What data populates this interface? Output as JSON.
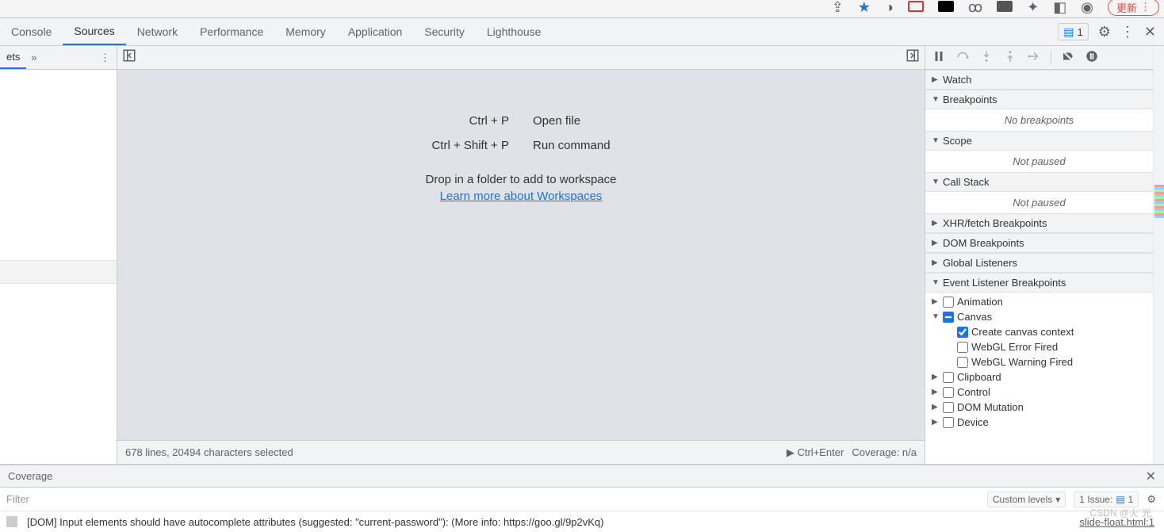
{
  "browser": {
    "update_label": "更新",
    "star": true
  },
  "devtools_tabs": {
    "items": [
      "Console",
      "Sources",
      "Network",
      "Performance",
      "Memory",
      "Application",
      "Security",
      "Lighthouse"
    ],
    "active": "Sources",
    "issues_label": "1"
  },
  "navigator": {
    "truncated_tab": "ets"
  },
  "editor": {
    "hints": [
      {
        "keys": "Ctrl + P",
        "action": "Open file"
      },
      {
        "keys": "Ctrl + Shift + P",
        "action": "Run command"
      }
    ],
    "drop_text": "Drop in a folder to add to workspace",
    "link_text": "Learn more about Workspaces",
    "status_left": "678 lines, 20494 characters selected",
    "status_run": "Ctrl+Enter",
    "status_coverage": "Coverage: n/a"
  },
  "debugger": {
    "panes": {
      "watch": {
        "title": "Watch",
        "expanded": false
      },
      "breakpoints": {
        "title": "Breakpoints",
        "expanded": true,
        "empty": "No breakpoints"
      },
      "scope": {
        "title": "Scope",
        "expanded": true,
        "msg": "Not paused"
      },
      "callstack": {
        "title": "Call Stack",
        "expanded": true,
        "msg": "Not paused"
      },
      "xhr": {
        "title": "XHR/fetch Breakpoints",
        "expanded": false
      },
      "dom_bp": {
        "title": "DOM Breakpoints",
        "expanded": false
      },
      "global": {
        "title": "Global Listeners",
        "expanded": false
      },
      "evt": {
        "title": "Event Listener Breakpoints",
        "expanded": true,
        "groups": [
          {
            "name": "Animation",
            "expanded": false,
            "checked": false
          },
          {
            "name": "Canvas",
            "expanded": true,
            "checked": "indeterminate",
            "children": [
              {
                "name": "Create canvas context",
                "checked": true
              },
              {
                "name": "WebGL Error Fired",
                "checked": false
              },
              {
                "name": "WebGL Warning Fired",
                "checked": false
              }
            ]
          },
          {
            "name": "Clipboard",
            "expanded": false,
            "checked": false
          },
          {
            "name": "Control",
            "expanded": false,
            "checked": false
          },
          {
            "name": "DOM Mutation",
            "expanded": false,
            "checked": false
          },
          {
            "name": "Device",
            "expanded": false,
            "checked": false
          }
        ]
      }
    }
  },
  "drawer": {
    "tab": "Coverage",
    "filter_placeholder": "Filter",
    "levels": "Custom levels",
    "issue_prefix": "1 Issue:",
    "issue_count": "1"
  },
  "console_msg": {
    "text": "[DOM] Input elements should have autocomplete attributes (suggested: \"current-password\"): (More info: https://goo.gl/9p2vKq)",
    "source": "slide-float.html:1"
  },
  "watermark": "CSDN @火`光"
}
